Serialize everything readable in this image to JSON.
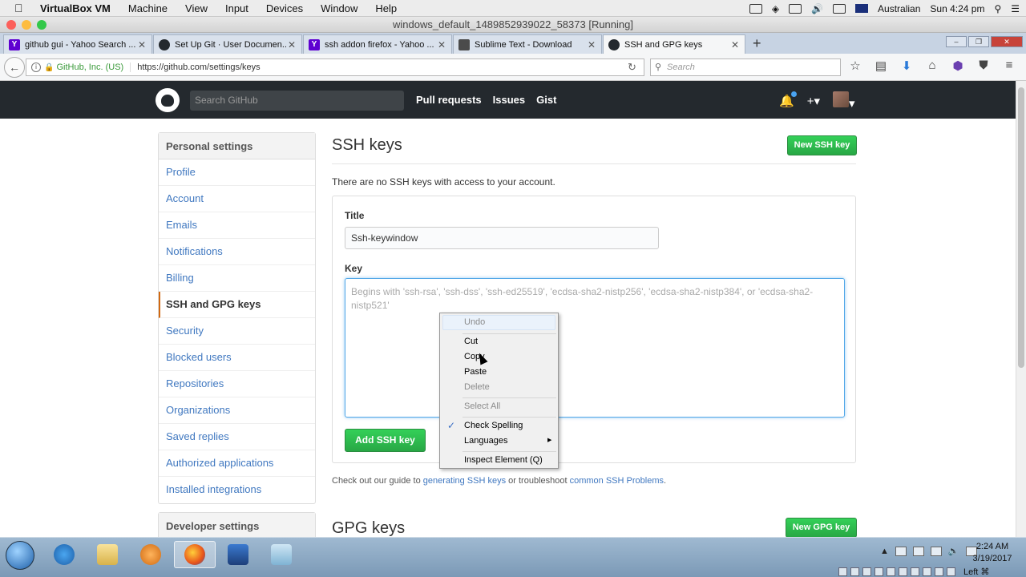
{
  "mac_menubar": {
    "app_name": "VirtualBox VM",
    "menus": [
      "Machine",
      "View",
      "Input",
      "Devices",
      "Window",
      "Help"
    ],
    "keyboard": "Australian",
    "clock": "Sun 4:24 pm"
  },
  "vm_window": {
    "title": "windows_default_1489852939022_58373 [Running]"
  },
  "browser": {
    "tabs": [
      {
        "label": "github gui - Yahoo Search ...",
        "icon": "yahoo-icon",
        "color": "#5f01d1"
      },
      {
        "label": "Set Up Git · User Documen...",
        "icon": "github-icon",
        "color": "#24292e"
      },
      {
        "label": "ssh addon firefox - Yahoo ...",
        "icon": "yahoo-icon",
        "color": "#5f01d1"
      },
      {
        "label": "Sublime Text - Download",
        "icon": "sublime-icon",
        "color": "#4b4b4b"
      },
      {
        "label": "SSH and GPG keys",
        "icon": "github-icon",
        "color": "#24292e"
      }
    ],
    "url_org": "GitHub, Inc. (US)",
    "url": "https://github.com/settings/keys",
    "search_placeholder": "Search"
  },
  "github": {
    "search_placeholder": "Search GitHub",
    "nav": [
      "Pull requests",
      "Issues",
      "Gist"
    ],
    "sidebar_heading": "Personal settings",
    "sidebar_items": [
      "Profile",
      "Account",
      "Emails",
      "Notifications",
      "Billing",
      "SSH and GPG keys",
      "Security",
      "Blocked users",
      "Repositories",
      "Organizations",
      "Saved replies",
      "Authorized applications",
      "Installed integrations"
    ],
    "sidebar_selected": "SSH and GPG keys",
    "developer_heading": "Developer settings",
    "ssh_title": "SSH keys",
    "new_ssh_label": "New SSH key",
    "no_keys_text": "There are no SSH keys with access to your account.",
    "title_label": "Title",
    "title_value": "Ssh-keywindow",
    "key_label": "Key",
    "key_placeholder": "Begins with 'ssh-rsa', 'ssh-dss', 'ssh-ed25519', 'ecdsa-sha2-nistp256', 'ecdsa-sha2-nistp384', or 'ecdsa-sha2-nistp521'",
    "add_ssh_label": "Add SSH key",
    "guide_prefix": "Check out our guide to",
    "guide_link1": "generating SSH keys",
    "guide_mid": "or troubleshoot",
    "guide_link2": "common SSH Problems",
    "guide_suffix": ".",
    "gpg_title": "GPG keys",
    "new_gpg_label": "New GPG key"
  },
  "context_menu": {
    "undo": "Undo",
    "cut": "Cut",
    "copy": "Copy",
    "paste": "Paste",
    "delete": "Delete",
    "select_all": "Select All",
    "check_spelling": "Check Spelling",
    "languages": "Languages",
    "inspect": "Inspect Element (Q)"
  },
  "taskbar": {
    "time": "2:24 AM",
    "date": "3/19/2017",
    "input_indicator": "Left ⌘"
  }
}
